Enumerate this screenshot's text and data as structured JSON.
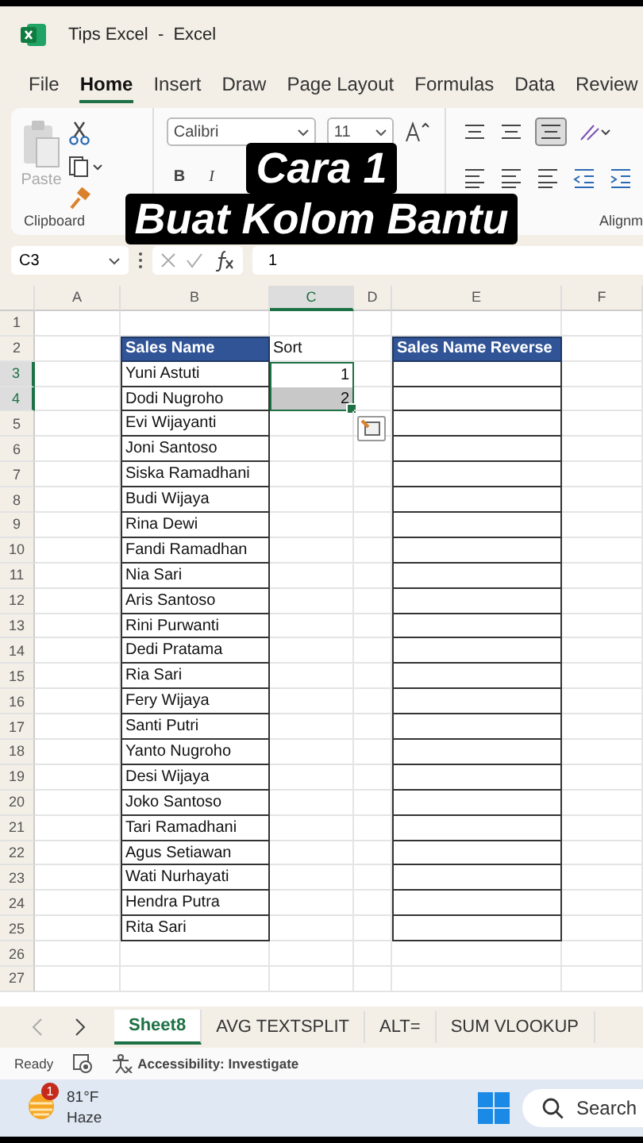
{
  "window": {
    "title": "Tips Excel  -  Excel"
  },
  "menu": [
    {
      "label": "File",
      "selected": false
    },
    {
      "label": "Home",
      "selected": true
    },
    {
      "label": "Insert",
      "selected": false
    },
    {
      "label": "Draw",
      "selected": false
    },
    {
      "label": "Page Layout",
      "selected": false
    },
    {
      "label": "Formulas",
      "selected": false
    },
    {
      "label": "Data",
      "selected": false
    },
    {
      "label": "Review",
      "selected": false
    }
  ],
  "ribbon": {
    "paste": "Paste",
    "font": "Calibri",
    "size": "11",
    "bold": "B",
    "italic": "I",
    "clipboard_group": "Clipboard",
    "alignment_group": "Alignm"
  },
  "caption": [
    "Cara 1",
    "Buat Kolom Bantu"
  ],
  "formula_bar": {
    "name_box": "C3",
    "value": "1"
  },
  "columns": [
    {
      "label": "A",
      "selected": false
    },
    {
      "label": "B",
      "selected": false
    },
    {
      "label": "C",
      "selected": true
    },
    {
      "label": "D",
      "selected": false
    },
    {
      "label": "E",
      "selected": false
    },
    {
      "label": "F",
      "selected": false
    }
  ],
  "rows": [
    {
      "header": "1",
      "selected": false,
      "cells": {}
    },
    {
      "header": "2",
      "selected": false,
      "cells": {
        "B": {
          "kind": "header",
          "text": "Sales Name"
        },
        "C": {
          "kind": "plain",
          "text": "Sort"
        },
        "E": {
          "kind": "header",
          "text": "Sales Name Reverse"
        }
      }
    },
    {
      "header": "3",
      "selected": true,
      "cells": {
        "B": {
          "kind": "table",
          "text": "Yuni Astuti"
        },
        "C": {
          "kind": "number",
          "text": "1",
          "selected": true,
          "active": true
        },
        "E": {
          "kind": "table"
        }
      }
    },
    {
      "header": "4",
      "selected": true,
      "cells": {
        "B": {
          "kind": "table",
          "text": "Dodi Nugroho"
        },
        "C": {
          "kind": "number",
          "text": "2",
          "selected": true,
          "active": false
        },
        "E": {
          "kind": "table"
        }
      }
    },
    {
      "header": "5",
      "selected": false,
      "cells": {
        "B": {
          "kind": "table",
          "text": "Evi Wijayanti"
        },
        "E": {
          "kind": "table"
        }
      }
    },
    {
      "header": "6",
      "selected": false,
      "cells": {
        "B": {
          "kind": "table",
          "text": "Joni Santoso"
        },
        "E": {
          "kind": "table"
        }
      }
    },
    {
      "header": "7",
      "selected": false,
      "cells": {
        "B": {
          "kind": "table",
          "text": "Siska Ramadhani"
        },
        "E": {
          "kind": "table"
        }
      }
    },
    {
      "header": "8",
      "selected": false,
      "cells": {
        "B": {
          "kind": "table",
          "text": "Budi Wijaya"
        },
        "E": {
          "kind": "table"
        }
      }
    },
    {
      "header": "9",
      "selected": false,
      "cells": {
        "B": {
          "kind": "table",
          "text": "Rina Dewi"
        },
        "E": {
          "kind": "table"
        }
      }
    },
    {
      "header": "10",
      "selected": false,
      "cells": {
        "B": {
          "kind": "table",
          "text": "Fandi Ramadhan"
        },
        "E": {
          "kind": "table"
        }
      }
    },
    {
      "header": "11",
      "selected": false,
      "cells": {
        "B": {
          "kind": "table",
          "text": "Nia Sari"
        },
        "E": {
          "kind": "table"
        }
      }
    },
    {
      "header": "12",
      "selected": false,
      "cells": {
        "B": {
          "kind": "table",
          "text": "Aris Santoso"
        },
        "E": {
          "kind": "table"
        }
      }
    },
    {
      "header": "13",
      "selected": false,
      "cells": {
        "B": {
          "kind": "table",
          "text": "Rini Purwanti"
        },
        "E": {
          "kind": "table"
        }
      }
    },
    {
      "header": "14",
      "selected": false,
      "cells": {
        "B": {
          "kind": "table",
          "text": "Dedi Pratama"
        },
        "E": {
          "kind": "table"
        }
      }
    },
    {
      "header": "15",
      "selected": false,
      "cells": {
        "B": {
          "kind": "table",
          "text": "Ria Sari"
        },
        "E": {
          "kind": "table"
        }
      }
    },
    {
      "header": "16",
      "selected": false,
      "cells": {
        "B": {
          "kind": "table",
          "text": "Fery Wijaya"
        },
        "E": {
          "kind": "table"
        }
      }
    },
    {
      "header": "17",
      "selected": false,
      "cells": {
        "B": {
          "kind": "table",
          "text": "Santi Putri"
        },
        "E": {
          "kind": "table"
        }
      }
    },
    {
      "header": "18",
      "selected": false,
      "cells": {
        "B": {
          "kind": "table",
          "text": "Yanto Nugroho"
        },
        "E": {
          "kind": "table"
        }
      }
    },
    {
      "header": "19",
      "selected": false,
      "cells": {
        "B": {
          "kind": "table",
          "text": "Desi Wijaya"
        },
        "E": {
          "kind": "table"
        }
      }
    },
    {
      "header": "20",
      "selected": false,
      "cells": {
        "B": {
          "kind": "table",
          "text": "Joko Santoso"
        },
        "E": {
          "kind": "table"
        }
      }
    },
    {
      "header": "21",
      "selected": false,
      "cells": {
        "B": {
          "kind": "table",
          "text": "Tari Ramadhani"
        },
        "E": {
          "kind": "table"
        }
      }
    },
    {
      "header": "22",
      "selected": false,
      "cells": {
        "B": {
          "kind": "table",
          "text": "Agus Setiawan"
        },
        "E": {
          "kind": "table"
        }
      }
    },
    {
      "header": "23",
      "selected": false,
      "cells": {
        "B": {
          "kind": "table",
          "text": "Wati Nurhayati"
        },
        "E": {
          "kind": "table"
        }
      }
    },
    {
      "header": "24",
      "selected": false,
      "cells": {
        "B": {
          "kind": "table",
          "text": "Hendra Putra"
        },
        "E": {
          "kind": "table"
        }
      }
    },
    {
      "header": "25",
      "selected": false,
      "cells": {
        "B": {
          "kind": "table",
          "text": "Rita Sari"
        },
        "E": {
          "kind": "table"
        }
      }
    },
    {
      "header": "26",
      "selected": false,
      "cells": {}
    },
    {
      "header": "27",
      "selected": false,
      "cells": {}
    }
  ],
  "sheet_tabs": [
    {
      "label": "Sheet8",
      "selected": true
    },
    {
      "label": "AVG TEXTSPLIT",
      "selected": false
    },
    {
      "label": "ALT=",
      "selected": false
    },
    {
      "label": "SUM VLOOKUP",
      "selected": false
    }
  ],
  "status_bar": {
    "mode": "Ready",
    "accessibility": "Accessibility: Investigate"
  },
  "taskbar": {
    "weather_badge": "1",
    "temperature": "81°F",
    "condition": "Haze",
    "search": "Search"
  }
}
